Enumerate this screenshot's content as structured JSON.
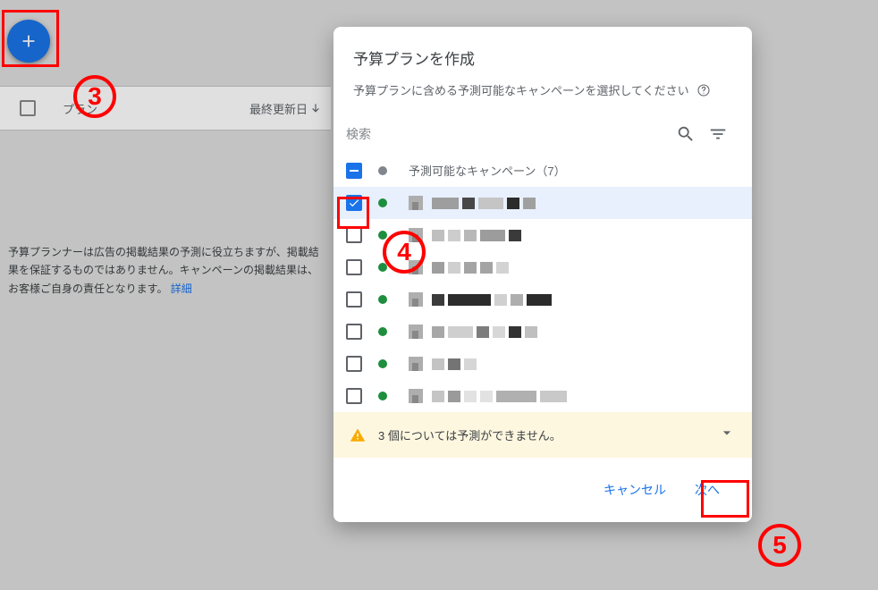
{
  "fab": {
    "name": "add"
  },
  "table": {
    "col_plan": "プラン",
    "col_date": "最終更新日"
  },
  "disclaimer": {
    "text": "予算プランナーは広告の掲載結果の予測に役立ちますが、掲載結果を保証するものではありません。キャンペーンの掲載結果は、お客様ご自身の責任となります。 ",
    "link": "詳細"
  },
  "dialog": {
    "title": "予算プランを作成",
    "subtitle": "予算プランに含める予測可能なキャンペーンを選択してください",
    "search_placeholder": "検索",
    "group_label": "予測可能なキャンペーン（7）",
    "warning_text": "3 個については予測ができません。",
    "cancel": "キャンセル",
    "next": "次へ"
  },
  "annotations": {
    "three": "3",
    "four": "4",
    "five": "5"
  }
}
